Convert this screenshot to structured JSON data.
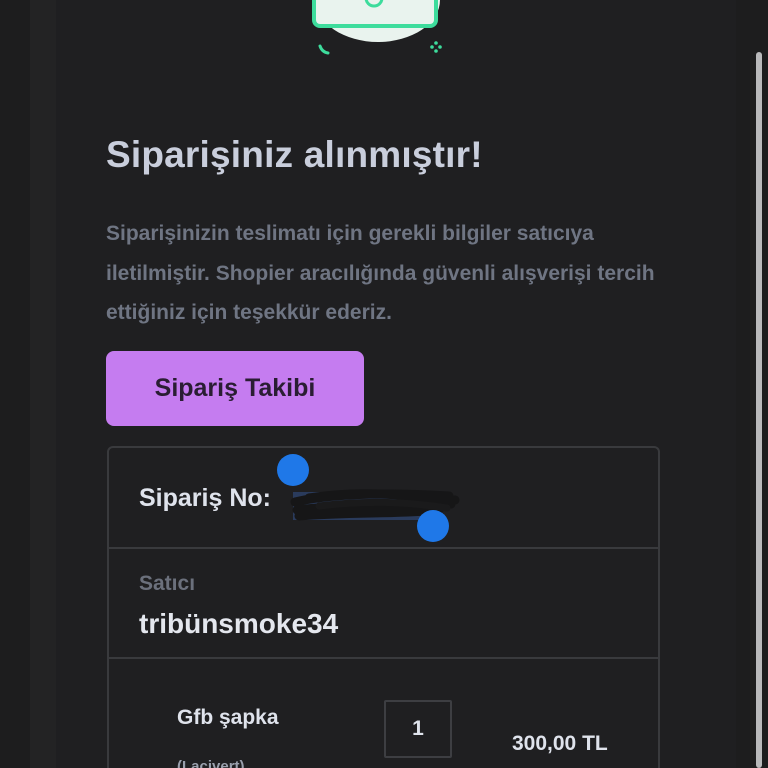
{
  "header": {
    "title": "Siparişiniz alınmıştır!",
    "description": "Siparişinizin teslimatı için gerekli bilgiler satıcıya iletilmiştir. Shopier aracılığında güvenli alışverişi tercih ettiğiniz için teşekkür ederiz."
  },
  "actions": {
    "track_label": "Sipariş Takibi"
  },
  "order": {
    "number_label": "Sipariş No:",
    "seller_label": "Satıcı",
    "seller_name": "tribünsmoke34"
  },
  "item": {
    "name": "Gfb şapka",
    "variant": "(Lacivert)",
    "quantity": "1",
    "price": "300,00 TL"
  },
  "colors": {
    "background": "#1f1f21",
    "accent": "#c57cf0",
    "title": "#c9cedc",
    "muted": "#6f7583",
    "selection_handle": "#1f78e8",
    "illustration": "#3ddc9c"
  },
  "icons": [
    "success-illustration-icon",
    "sparkle-icon"
  ]
}
